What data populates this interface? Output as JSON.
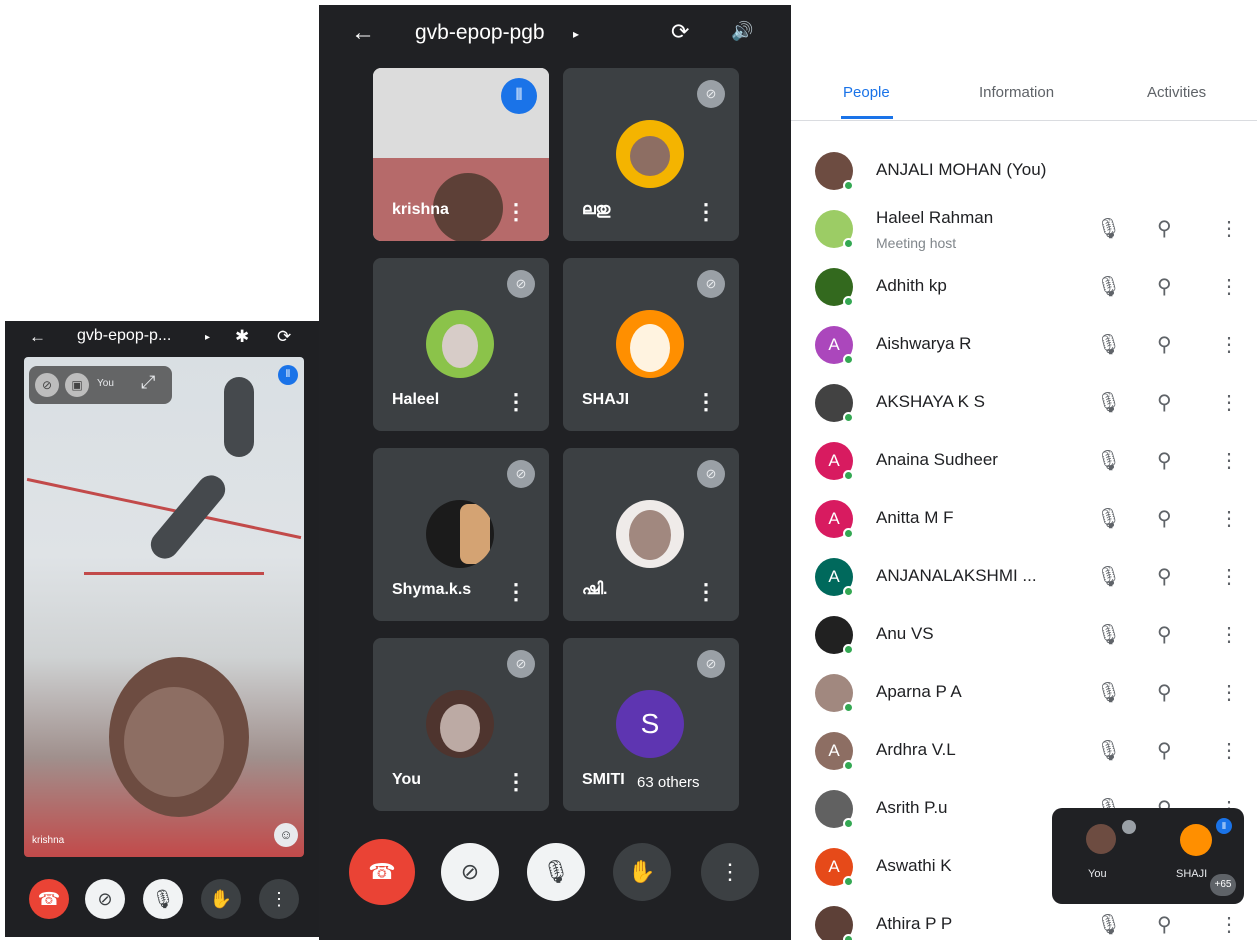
{
  "left_phone": {
    "title": "gvb-epop-p...",
    "caret": "▸",
    "back_glyph": "←",
    "bluetooth_glyph": "✱",
    "switch_glyph": "⟳",
    "self_view": {
      "label": "You"
    },
    "video_name": "krishna",
    "controls": {
      "end": "☎",
      "camera": "⊘",
      "mic": "🎙",
      "hand": "✋",
      "more": "⋮"
    }
  },
  "middle_phone": {
    "title": "gvb-epop-pgb",
    "caret": "▸",
    "back_glyph": "←",
    "switch_glyph": "⟳",
    "speaker_glyph": "🔊",
    "tiles": [
      {
        "name": "krishna",
        "type": "video"
      },
      {
        "name": "ലതു",
        "type": "avatar",
        "color": "#f4b400"
      },
      {
        "name": "Haleel",
        "type": "avatar",
        "color": "#8bc34a"
      },
      {
        "name": "SHAJI",
        "type": "avatar",
        "color": "#ff8f00"
      },
      {
        "name": "Shyma.k.s",
        "type": "avatar",
        "color": "#3e2723"
      },
      {
        "name": "ഷി.",
        "type": "avatar",
        "color": "#d7ccc8"
      },
      {
        "name": "You",
        "type": "avatar",
        "color": "#795548"
      },
      {
        "name": "SMITI",
        "type": "letter",
        "letter": "S",
        "color": "#5e35b1",
        "others": "63 others"
      }
    ],
    "controls": {
      "end": "☎",
      "camera": "⊘",
      "mic": "🎙",
      "hand": "✋",
      "more": "⋮"
    }
  },
  "right_panel": {
    "tabs": [
      "People",
      "Information",
      "Activities"
    ],
    "active_tab": "People",
    "accent": "#1a73e8",
    "people": [
      {
        "name": "ANJALI MOHAN (You)",
        "initial": "",
        "color": "#6d4c41",
        "you": true
      },
      {
        "name": "Haleel Rahman",
        "sub": "Meeting host",
        "initial": "",
        "color": "#9ccc65"
      },
      {
        "name": "Adhith kp",
        "initial": "",
        "color": "#33691e"
      },
      {
        "name": "Aishwarya R",
        "initial": "A",
        "color": "#ab47bc"
      },
      {
        "name": "AKSHAYA K S",
        "initial": "",
        "color": "#424242"
      },
      {
        "name": "Anaina Sudheer",
        "initial": "A",
        "color": "#d81b60"
      },
      {
        "name": "Anitta M F",
        "initial": "A",
        "color": "#d81b60"
      },
      {
        "name": "ANJANALAKSHMI ...",
        "initial": "A",
        "color": "#00695c"
      },
      {
        "name": "Anu VS",
        "initial": "",
        "color": "#212121"
      },
      {
        "name": "Aparna P A",
        "initial": "",
        "color": "#a1887f"
      },
      {
        "name": "Ardhra V.L",
        "initial": "A",
        "color": "#8d6e63"
      },
      {
        "name": "Asrith P.u",
        "initial": "",
        "color": "#616161"
      },
      {
        "name": "Aswathi K",
        "initial": "A",
        "color": "#e64a19"
      },
      {
        "name": "Athira P P",
        "initial": "",
        "color": "#5d4037"
      }
    ],
    "icons": {
      "mute": "🎙",
      "pin": "⚲",
      "more": "⋮"
    },
    "mini": {
      "you_label": "You",
      "shaji_label": "SHAJI",
      "badge": "+65"
    }
  }
}
